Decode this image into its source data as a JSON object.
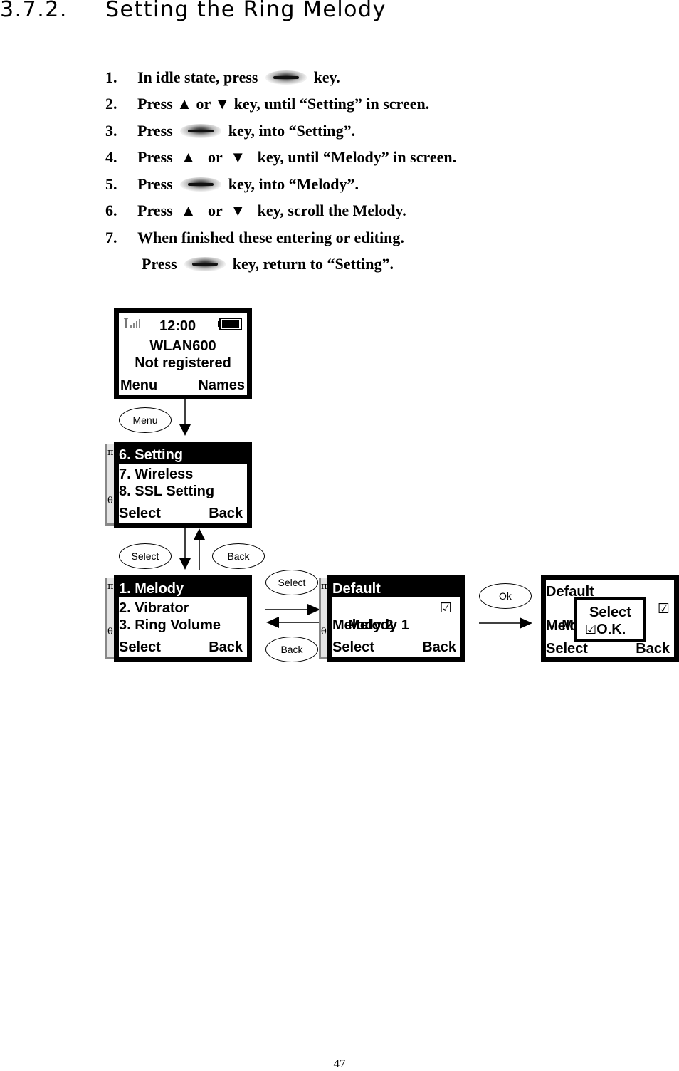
{
  "heading": {
    "number": "3.7.2.",
    "title": "Setting the Ring Melody"
  },
  "steps": [
    {
      "num": "1.",
      "before": "In idle state, press",
      "key": "soft-key",
      "after": "key."
    },
    {
      "num": "2.",
      "before": "Press ▲ or ▼ key, until “Setting” in screen.",
      "key": null,
      "after": ""
    },
    {
      "num": "3.",
      "before": "Press",
      "key": "soft-key",
      "after": "key, into “Setting”."
    },
    {
      "num": "4.",
      "before": "Press  ▲   or  ▼   key, until “Melody” in screen.",
      "key": null,
      "after": ""
    },
    {
      "num": "5.",
      "before": "Press",
      "key": "soft-key",
      "after": "key, into “Melody”."
    },
    {
      "num": "6.",
      "before": "Press  ▲   or  ▼   key, scroll the Melody.",
      "key": null,
      "after": ""
    },
    {
      "num": "7.",
      "before": "When finished these entering or editing.",
      "key": null,
      "after": ""
    },
    {
      "num": "",
      "before": "Press",
      "key": "soft-key",
      "after": "key, return to “Setting”."
    }
  ],
  "diagram": {
    "idle_screen": {
      "time": "12:00",
      "line1": "WLAN600",
      "line2": "Not registered",
      "soft_left": "Menu",
      "soft_right": "Names"
    },
    "main_menu_screen": {
      "items": [
        "6. Setting",
        "7. Wireless",
        "8. SSL Setting"
      ],
      "selected_index": 0,
      "soft_left": "Select",
      "soft_right": "Back"
    },
    "setting_screen": {
      "items": [
        "1. Melody",
        "2. Vibrator",
        "3. Ring Volume"
      ],
      "selected_index": 0,
      "soft_left": "Select",
      "soft_right": "Back"
    },
    "melody_screen": {
      "items": [
        "Default",
        "Melody 1",
        "Melody 2"
      ],
      "selected_index": 0,
      "checked_item": "Melody 1",
      "soft_left": "Select",
      "soft_right": "Back"
    },
    "confirm_screen": {
      "items": [
        "Default",
        "Melo",
        "Melo"
      ],
      "soft_left": "Select",
      "soft_right": "Back",
      "popup": {
        "line1": "Select",
        "line2": "O.K."
      }
    },
    "scroll_indicator": {
      "top": "π",
      "bottom": "θ"
    },
    "check_mark": "☑",
    "ovals": {
      "menu": "Menu",
      "select1": "Select",
      "back1": "Back",
      "select2": "Select",
      "back2": "Back",
      "ok": "Ok"
    }
  },
  "page_number": "47"
}
